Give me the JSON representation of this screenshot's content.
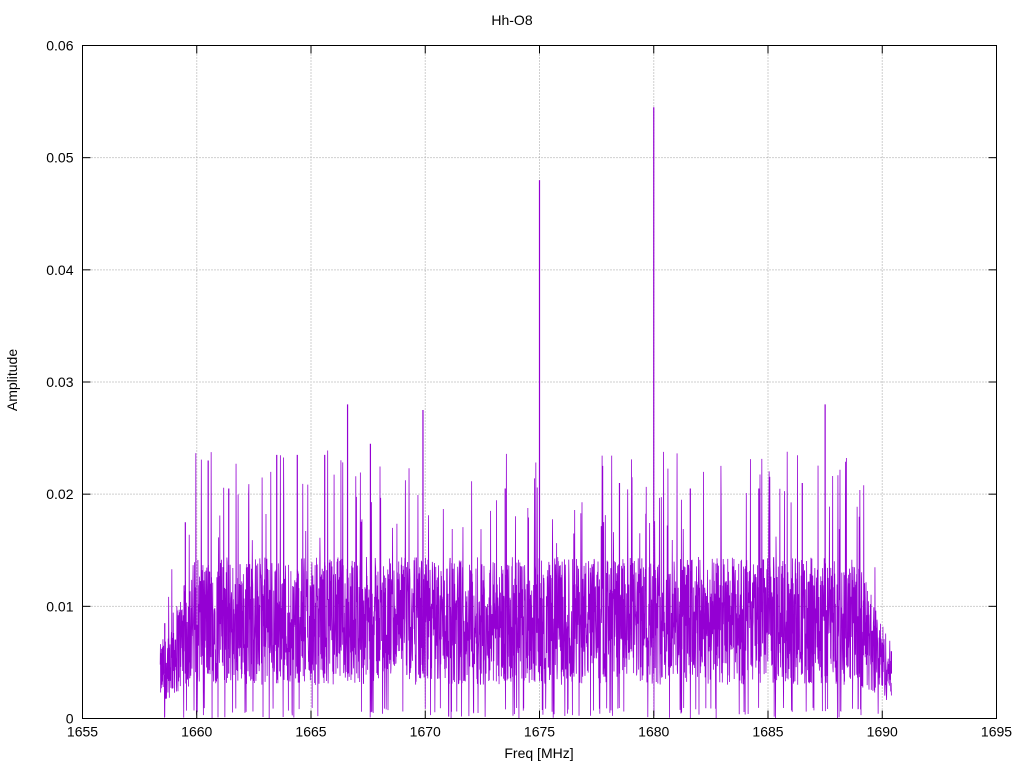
{
  "chart_data": {
    "type": "line",
    "title": "Hh-O8",
    "xlabel": "Freq [MHz]",
    "ylabel": "Amplitude",
    "xlim": [
      1655,
      1695
    ],
    "ylim": [
      0,
      0.06
    ],
    "x_ticks": [
      "1655",
      "1660",
      "1665",
      "1670",
      "1675",
      "1680",
      "1685",
      "1690",
      "1695"
    ],
    "y_ticks": [
      "0",
      "0.01",
      "0.02",
      "0.03",
      "0.04",
      "0.05",
      "0.06"
    ],
    "grid": true,
    "series_color": "#9400d3",
    "series": [
      {
        "x_range": [
          1658.4,
          1690.4
        ],
        "baseline_amplitude_range": [
          0.002,
          0.012
        ],
        "peaks": [
          {
            "x": 1658.6,
            "y": 0.0085
          },
          {
            "x": 1659.5,
            "y": 0.0175
          },
          {
            "x": 1660.5,
            "y": 0.023
          },
          {
            "x": 1661.4,
            "y": 0.0205
          },
          {
            "x": 1663.5,
            "y": 0.0235
          },
          {
            "x": 1664.4,
            "y": 0.0235
          },
          {
            "x": 1665.6,
            "y": 0.0235
          },
          {
            "x": 1666.6,
            "y": 0.028
          },
          {
            "x": 1667.6,
            "y": 0.0245
          },
          {
            "x": 1669.9,
            "y": 0.0275
          },
          {
            "x": 1673.5,
            "y": 0.0205
          },
          {
            "x": 1675.0,
            "y": 0.048
          },
          {
            "x": 1678.5,
            "y": 0.021
          },
          {
            "x": 1680.0,
            "y": 0.0545
          },
          {
            "x": 1681.6,
            "y": 0.0205
          },
          {
            "x": 1684.6,
            "y": 0.0205
          },
          {
            "x": 1686.5,
            "y": 0.021
          },
          {
            "x": 1687.5,
            "y": 0.028
          },
          {
            "x": 1689.0,
            "y": 0.0105
          },
          {
            "x": 1690.4,
            "y": 0.006
          }
        ]
      }
    ]
  }
}
